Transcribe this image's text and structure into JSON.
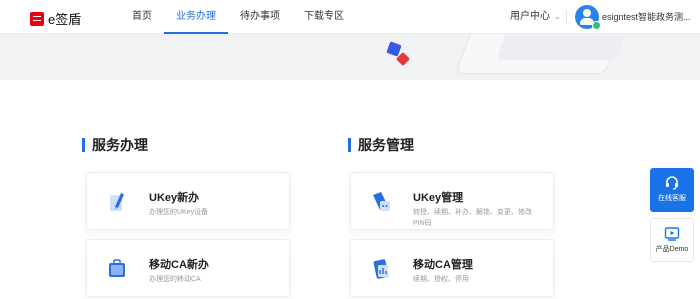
{
  "header": {
    "logo_text": "e签盾",
    "nav": [
      {
        "label": "首页"
      },
      {
        "label": "业务办理"
      },
      {
        "label": "待办事项"
      },
      {
        "label": "下载专区"
      }
    ],
    "user_center": "用户中心",
    "username": "esigntest智能政务测..."
  },
  "sections": [
    {
      "title": "服务办理",
      "cards": [
        {
          "title": "UKey新办",
          "desc": "办理您的UKey设备",
          "icon": "ukey-pen-icon"
        },
        {
          "title": "移动CA新办",
          "desc": "办理您的移动CA",
          "icon": "mobile-ca-briefcase-icon"
        }
      ]
    },
    {
      "title": "服务管理",
      "cards": [
        {
          "title": "UKey管理",
          "desc": "转授、续期、补办、解锁、变更、修改PIN码",
          "icon": "ukey-manage-icon"
        },
        {
          "title": "移动CA管理",
          "desc": "续期、授权、停用",
          "icon": "mobile-ca-manage-icon"
        }
      ]
    }
  ],
  "float": {
    "online_service": "在线客服",
    "product_demo": "产品Demo"
  },
  "colors": {
    "accent": "#1f6fe0",
    "brand_red": "#e60012"
  }
}
